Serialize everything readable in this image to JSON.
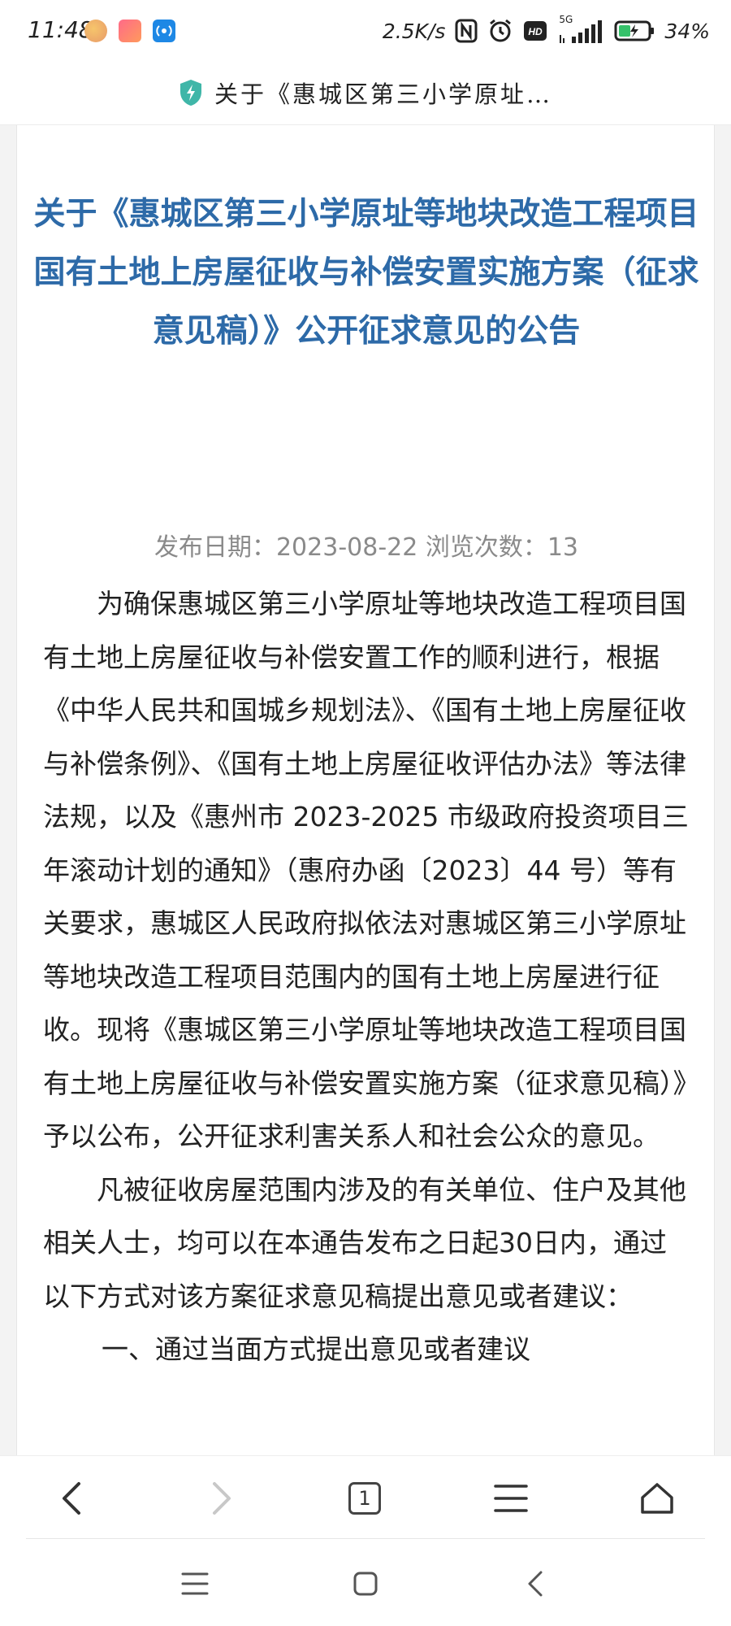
{
  "status_bar": {
    "time": "11:48",
    "network_speed": "2.5K/s",
    "signal_label": "5G",
    "battery": "34%"
  },
  "browser": {
    "page_title": "关于《惠城区第三小学原址…",
    "tab_count": "1"
  },
  "article": {
    "headline": "关于《惠城区第三小学原址等地块改造工程项目国有土地上房屋征收与补偿安置实施方案（征求意见稿）》公开征求意见的公告",
    "meta": "发布日期：2023-08-22  浏览次数：13",
    "paragraphs": [
      "为确保惠城区第三小学原址等地块改造工程项目国有土地上房屋征收与补偿安置工作的顺利进行，根据《中华人民共和国城乡规划法》、《国有土地上房屋征收与补偿条例》、《国有土地上房屋征收评估办法》等法律法规，以及《惠州市 2023-2025 市级政府投资项目三年滚动计划的通知》（惠府办函〔2023〕44 号）等有关要求，惠城区人民政府拟依法对惠城区第三小学原址等地块改造工程项目范围内的国有土地上房屋进行征收。现将《惠城区第三小学原址等地块改造工程项目国有土地上房屋征收与补偿安置实施方案（征求意见稿）》予以公布，公开征求利害关系人和社会公众的意见。",
      "凡被征收房屋范围内涉及的有关单位、住户及其他相关人士，均可以在本通告发布之日起30日内，通过以下方式对该方案征求意见稿提出意见或者建议："
    ],
    "section_heading": "一、通过当面方式提出意见或者建议"
  },
  "colors": {
    "headline": "#2d6aa8",
    "meta": "#8a8a8a",
    "shield": "#3fb6a8"
  }
}
